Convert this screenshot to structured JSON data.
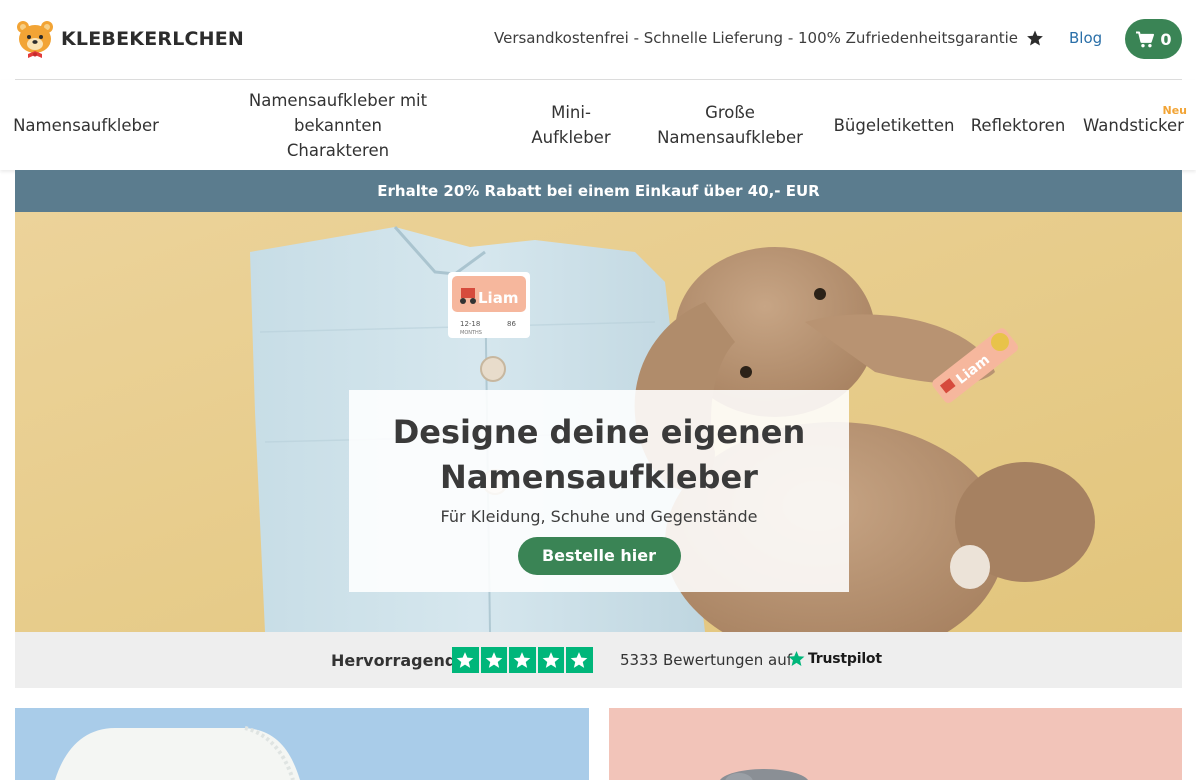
{
  "header": {
    "logo_text": "KLEBEKERLCHEN",
    "usp_text": "Versandkostenfrei - Schnelle Lieferung - 100% Zufriedenheitsgarantie",
    "blog_label": "Blog",
    "cart_count": "0"
  },
  "nav": {
    "items": [
      {
        "lines": [
          "Namensaufkleber"
        ]
      },
      {
        "lines": [
          "Namensaufkleber mit bekannten",
          "Charakteren"
        ]
      },
      {
        "lines": [
          "Mini-",
          "Aufkleber"
        ]
      },
      {
        "lines": [
          "Große",
          "Namensaufkleber"
        ]
      },
      {
        "lines": [
          "Bügeletiketten"
        ]
      },
      {
        "lines": [
          "Reflektoren"
        ]
      },
      {
        "lines": [
          "Wandsticker"
        ],
        "badge": "Neu"
      }
    ]
  },
  "promo": {
    "text": "Erhalte 20% Rabatt bei einem Einkauf über 40,- EUR"
  },
  "hero": {
    "title_line1": "Designe deine eigenen",
    "title_line2": "Namensaufkleber",
    "subtitle": "Für Kleidung, Schuhe und Gegenstände",
    "cta_label": "Bestelle hier",
    "label_name": "Liam",
    "label_size": "12-18",
    "label_size_unit": "MONTHS",
    "label_cm": "86"
  },
  "trust": {
    "rating_label": "Hervorragend",
    "stars": 5,
    "count_text": "5333 Bewertungen auf",
    "brand": "Trustpilot"
  },
  "colors": {
    "accent_green": "#3a8455",
    "promo_bg": "#5b7c8e",
    "link_blue": "#2a6fa8",
    "trust_green": "#00b67a",
    "badge_orange": "#f2a435"
  }
}
